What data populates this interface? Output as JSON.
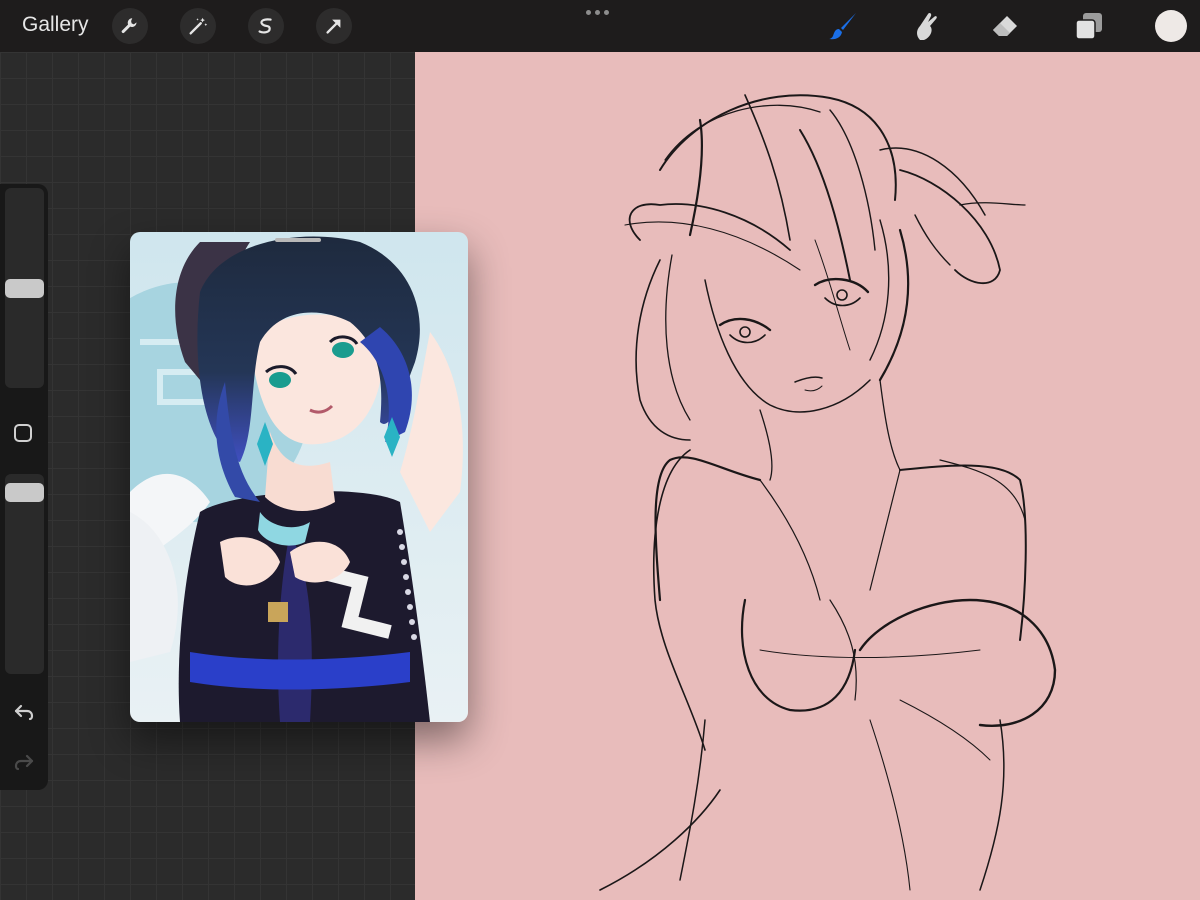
{
  "topbar": {
    "gallery_label": "Gallery",
    "tools_left": [
      "wrench-icon",
      "magic-wand-icon",
      "selection-icon",
      "transform-arrow-icon"
    ],
    "tools_right": [
      "brush-icon",
      "smudge-icon",
      "eraser-icon",
      "layers-icon"
    ],
    "active_tool": "brush-icon",
    "brush_color": "#1a6fe8",
    "current_color": "#eee9e6"
  },
  "sidebar": {
    "brush_size_level": 0.5,
    "opacity_level": 0.05,
    "buttons": [
      "modify-square-icon",
      "undo-icon",
      "redo-icon"
    ]
  },
  "canvas": {
    "background_color": "#e8bcbb",
    "content": "sketch-drawing"
  },
  "reference": {
    "content": "reference-image"
  }
}
